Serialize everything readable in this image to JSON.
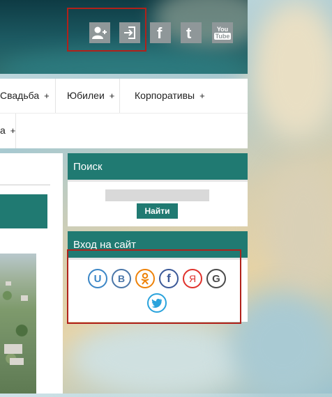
{
  "header": {
    "icons": [
      {
        "name": "register-user-icon"
      },
      {
        "name": "login-icon"
      },
      {
        "name": "facebook-icon"
      },
      {
        "name": "twitter-icon"
      },
      {
        "name": "youtube-icon",
        "text_top": "You",
        "text_bottom": "Tube"
      }
    ]
  },
  "nav": {
    "items": [
      {
        "label": "Свадьба",
        "plus": "+"
      },
      {
        "label": "Юбилеи",
        "plus": "+"
      },
      {
        "label": "Корпоративы",
        "plus": "+"
      },
      {
        "label": "а",
        "plus": "+"
      }
    ]
  },
  "search_widget": {
    "title": "Поиск",
    "input_value": "",
    "button_label": "Найти"
  },
  "login_widget": {
    "title": "Вход на сайт",
    "providers": [
      {
        "name": "ucoz",
        "glyph": "U",
        "color": "#3b86c6"
      },
      {
        "name": "vkontakte",
        "glyph": "B",
        "color": "#4a76a8"
      },
      {
        "name": "odnoklassniki",
        "glyph": "ок",
        "color": "#ee8208"
      },
      {
        "name": "facebook",
        "glyph": "f",
        "color": "#3b5998"
      },
      {
        "name": "yandex",
        "glyph": "Я",
        "color": "#e0312b"
      },
      {
        "name": "google",
        "glyph": "G",
        "color": "#4a4a4a"
      },
      {
        "name": "twitter",
        "glyph": "t",
        "color": "#2aa3dc"
      }
    ]
  },
  "colors": {
    "accent": "#207a72",
    "highlight_frame": "#b1211a"
  }
}
